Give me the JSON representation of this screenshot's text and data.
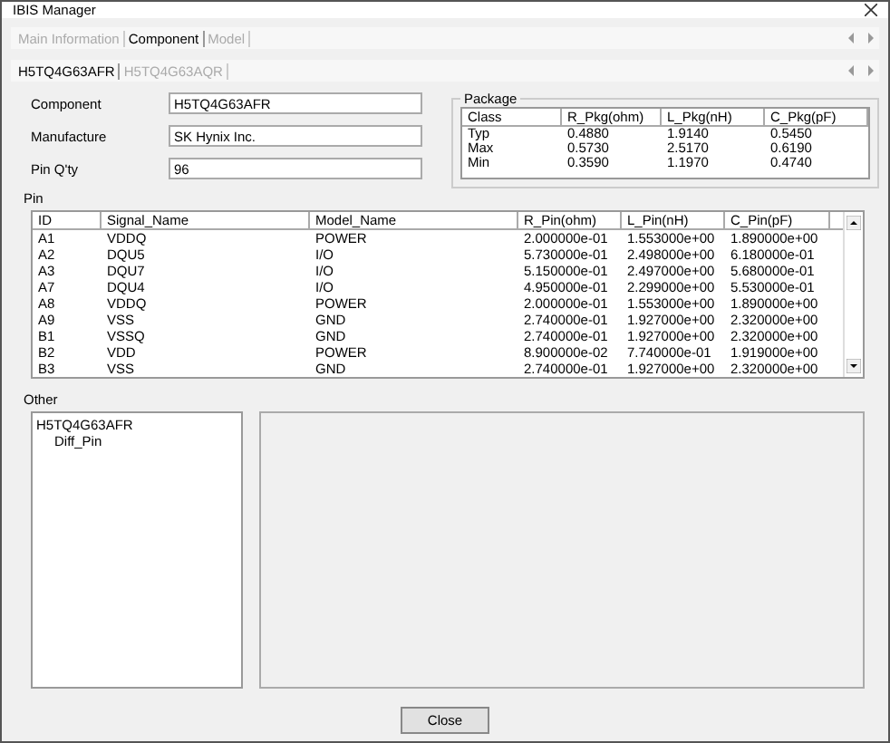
{
  "window": {
    "title": "IBIS Manager"
  },
  "tabs": [
    {
      "label": "Main Information",
      "selected": false
    },
    {
      "label": "Component",
      "selected": true
    },
    {
      "label": "Model",
      "selected": false
    }
  ],
  "component_tabs": [
    {
      "label": "H5TQ4G63AFR",
      "selected": true
    },
    {
      "label": "H5TQ4G63AQR",
      "selected": false
    }
  ],
  "fields": [
    {
      "label": "Component",
      "value": "H5TQ4G63AFR"
    },
    {
      "label": "Manufacture",
      "value": "SK Hynix Inc."
    },
    {
      "label": "Pin Q'ty",
      "value": "96"
    }
  ],
  "package": {
    "title": "Package",
    "columns": [
      "Class",
      "R_Pkg(ohm)",
      "L_Pkg(nH)",
      "C_Pkg(pF)"
    ],
    "rows": [
      [
        "Typ",
        "0.4880",
        "1.9140",
        "0.5450"
      ],
      [
        "Max",
        "0.5730",
        "2.5170",
        "0.6190"
      ],
      [
        "Min",
        "0.3590",
        "1.1970",
        "0.4740"
      ]
    ]
  },
  "pin": {
    "title": "Pin",
    "columns": [
      "ID",
      "Signal_Name",
      "Model_Name",
      "R_Pin(ohm)",
      "L_Pin(nH)",
      "C_Pin(pF)"
    ],
    "rows": [
      [
        "A1",
        "VDDQ",
        "POWER",
        "2.000000e-01",
        "1.553000e+00",
        "1.890000e+00"
      ],
      [
        "A2",
        "DQU5",
        "I/O",
        "5.730000e-01",
        "2.498000e+00",
        "6.180000e-01"
      ],
      [
        "A3",
        "DQU7",
        "I/O",
        "5.150000e-01",
        "2.497000e+00",
        "5.680000e-01"
      ],
      [
        "A7",
        "DQU4",
        "I/O",
        "4.950000e-01",
        "2.299000e+00",
        "5.530000e-01"
      ],
      [
        "A8",
        "VDDQ",
        "POWER",
        "2.000000e-01",
        "1.553000e+00",
        "1.890000e+00"
      ],
      [
        "A9",
        "VSS",
        "GND",
        "2.740000e-01",
        "1.927000e+00",
        "2.320000e+00"
      ],
      [
        "B1",
        "VSSQ",
        "GND",
        "2.740000e-01",
        "1.927000e+00",
        "2.320000e+00"
      ],
      [
        "B2",
        "VDD",
        "POWER",
        "8.900000e-02",
        "7.740000e-01",
        "1.919000e+00"
      ],
      [
        "B3",
        "VSS",
        "GND",
        "2.740000e-01",
        "1.927000e+00",
        "2.320000e+00"
      ]
    ]
  },
  "other": {
    "title": "Other",
    "tree": [
      {
        "label": "H5TQ4G63AFR",
        "children": [
          {
            "label": "Diff_Pin"
          }
        ]
      }
    ]
  },
  "buttons": [
    {
      "label": "Close"
    }
  ]
}
